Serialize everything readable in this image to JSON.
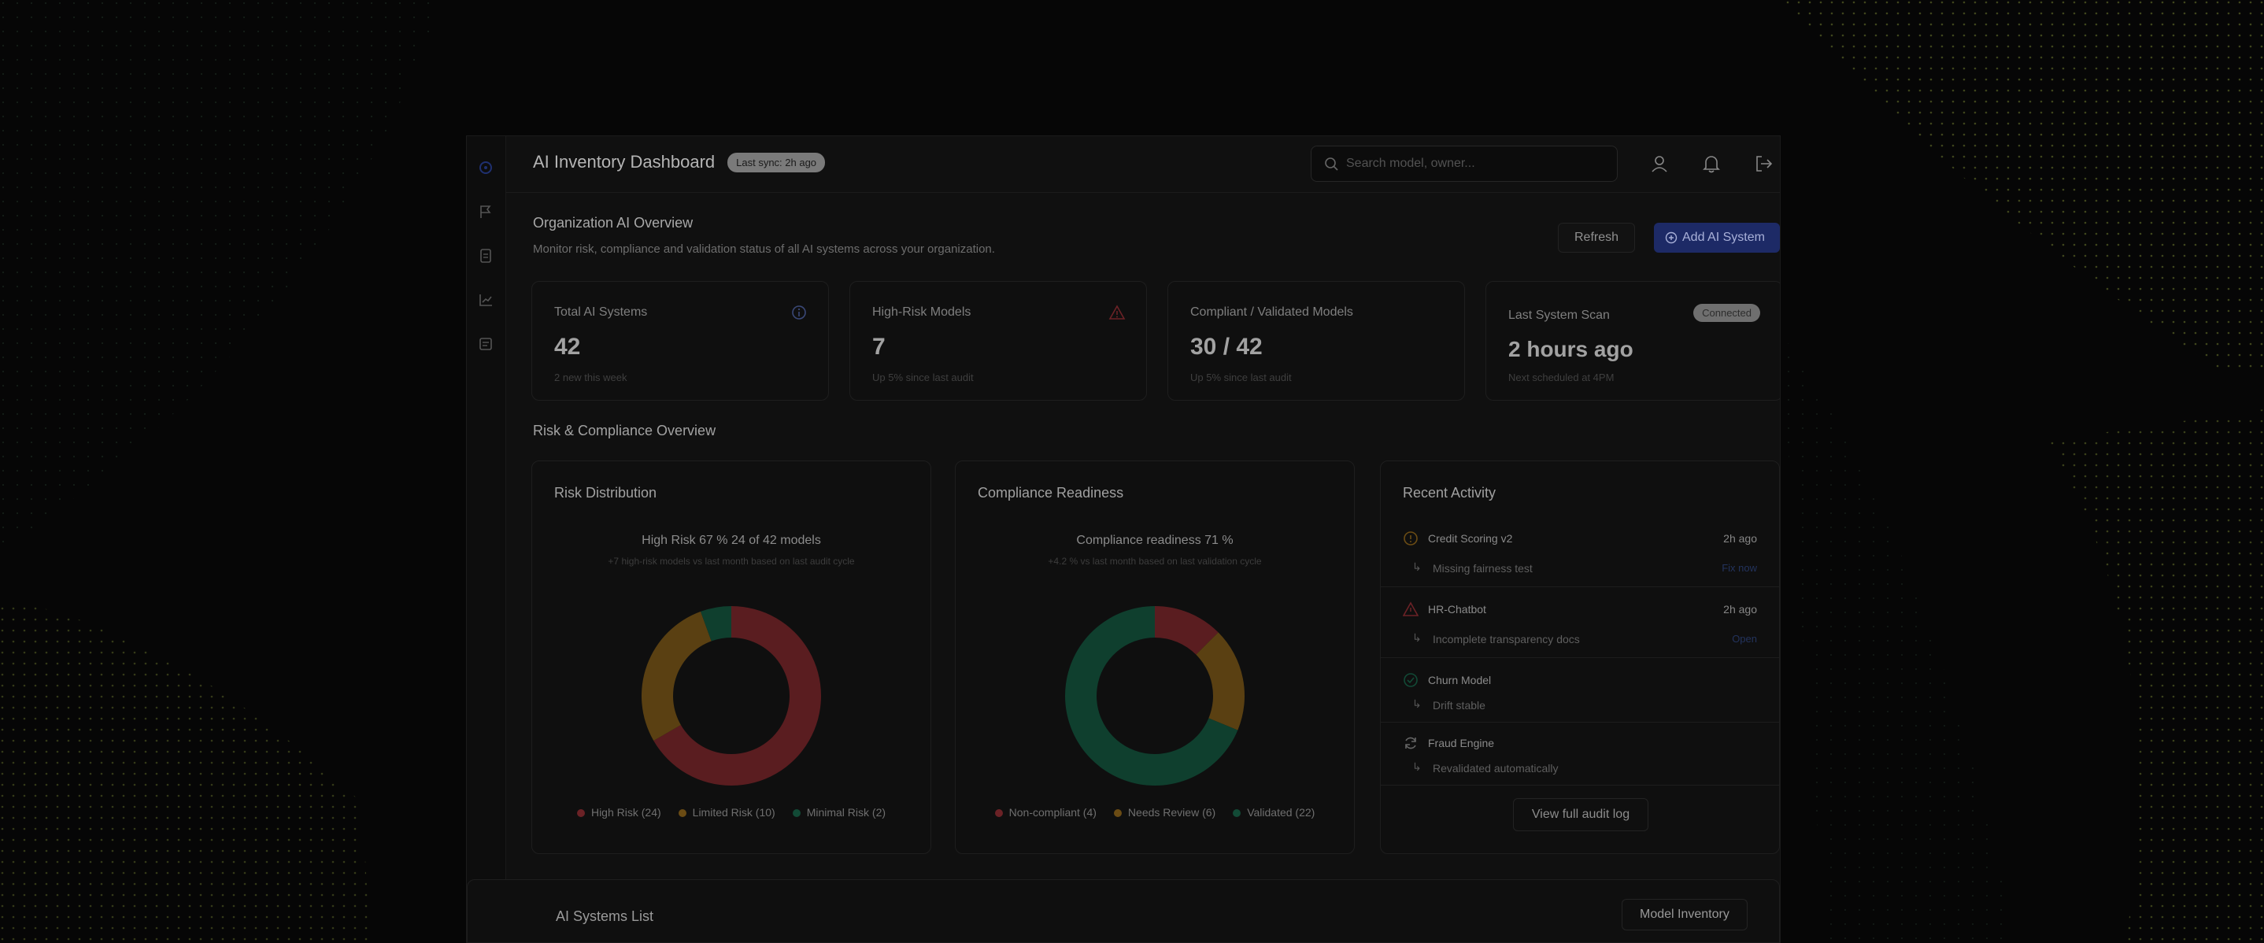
{
  "header": {
    "title": "AI Inventory Dashboard",
    "sync_badge": "Last sync: 2h ago",
    "search_placeholder": "Search model, owner..."
  },
  "overview": {
    "title": "Organization AI Overview",
    "subtitle": "Monitor risk, compliance and validation status of all AI systems across your organization.",
    "refresh_label": "Refresh",
    "add_label": "Add AI System"
  },
  "kpis": [
    {
      "label": "Total AI Systems",
      "value": "42",
      "sub": "2 new this week",
      "icon": "info-icon"
    },
    {
      "label": "High-Risk Models",
      "value": "7",
      "sub": "Up 5% since last audit",
      "icon": "warning-icon"
    },
    {
      "label": "Compliant / Validated Models",
      "value": "30 / 42",
      "sub": "Up 5% since last audit"
    },
    {
      "label": "Last System Scan",
      "value": "2 hours ago",
      "sub": "Next scheduled at 4PM",
      "badge": "Connected"
    }
  ],
  "risk_section": {
    "title": "Risk & Compliance Overview"
  },
  "risk_card": {
    "title": "Risk Distribution",
    "headline": "High Risk 67 % 24 of 42 models",
    "sub": "+7 high-risk models vs last month based on last audit cycle",
    "legend": [
      "High Risk (24)",
      "Limited Risk (10)",
      "Minimal Risk (2)"
    ]
  },
  "compliance_card": {
    "title": "Compliance Readiness",
    "headline": "Compliance readiness 71 %",
    "sub": "+4.2 % vs last month based on last validation cycle",
    "legend": [
      "Non-compliant (4)",
      "Needs Review (6)",
      "Validated (22)"
    ]
  },
  "chart_data": [
    {
      "type": "pie",
      "title": "Risk Distribution",
      "categories": [
        "High Risk",
        "Limited Risk",
        "Minimal Risk"
      ],
      "values": [
        24,
        10,
        2
      ],
      "colors": [
        "#5a1d20",
        "#5a4012",
        "#0f3f2e"
      ]
    },
    {
      "type": "pie",
      "title": "Compliance Readiness",
      "categories": [
        "Non-compliant",
        "Needs Review",
        "Validated"
      ],
      "values": [
        4,
        6,
        22
      ],
      "colors": [
        "#5a1d20",
        "#5a4012",
        "#0f3f2e"
      ]
    }
  ],
  "activity": {
    "title": "Recent Activity",
    "items": [
      {
        "name": "Credit Scoring v2",
        "time": "2h ago",
        "desc": "Missing fairness test",
        "link": "Fix now",
        "icon": "alert-circle-icon"
      },
      {
        "name": "HR-Chatbot",
        "time": "2h ago",
        "desc": "Incomplete transparency docs",
        "link": "Open",
        "icon": "warning-icon"
      },
      {
        "name": "Churn Model",
        "time": "",
        "desc": "Drift stable",
        "link": "",
        "icon": "check-circle-icon"
      },
      {
        "name": "Fraud Engine",
        "time": "",
        "desc": "Revalidated automatically",
        "link": "",
        "icon": "refresh-icon"
      }
    ],
    "view_all": "View full audit log"
  },
  "list": {
    "title": "AI Systems List",
    "inventory_button": "Model Inventory"
  }
}
